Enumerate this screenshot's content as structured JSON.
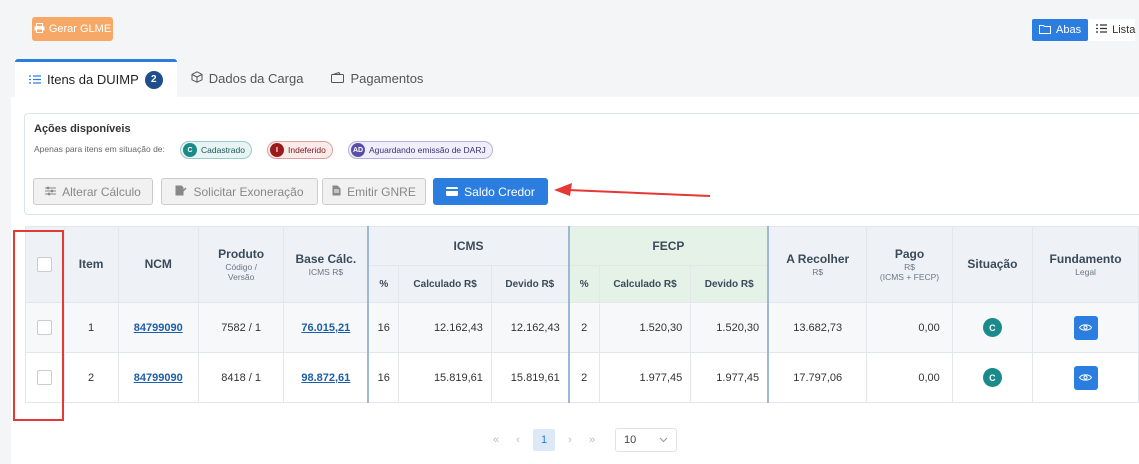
{
  "top": {
    "gerar_label": "Gerar GLME",
    "view_abas": "Abas",
    "view_lista": "Lista"
  },
  "tabs": [
    {
      "label": "Itens da DUIMP",
      "badge": "2"
    },
    {
      "label": "Dados da Carga"
    },
    {
      "label": "Pagamentos"
    }
  ],
  "actions": {
    "title": "Ações disponíveis",
    "note": "Apenas para itens em situação de:",
    "chips": [
      {
        "dot": "C",
        "label": "Cadastrado"
      },
      {
        "dot": "I",
        "label": "Indeferido"
      },
      {
        "dot": "AD",
        "label": "Aguardando emissão de DARJ"
      }
    ],
    "buttons": [
      "Alterar Cálculo",
      "Solicitar Exoneração",
      "Emitir GNRE",
      "Saldo Credor"
    ]
  },
  "table": {
    "headers": {
      "item": "Item",
      "ncm": "NCM",
      "produto": "Produto",
      "produto_sub": "Código / Versão",
      "base": "Base Cálc.",
      "base_sub": "ICMS R$",
      "icms": "ICMS",
      "fecp": "FECP",
      "pct": "%",
      "calculado": "Calculado R$",
      "devido": "Devido R$",
      "recolher": "A Recolher",
      "recolher_sub": "R$",
      "pago": "Pago",
      "pago_sub1": "R$",
      "pago_sub2": "(ICMS + FECP)",
      "situacao": "Situação",
      "fundamento": "Fundamento",
      "fundamento_sub": "Legal"
    },
    "rows": [
      {
        "item": "1",
        "ncm": "84799090",
        "produto": "7582 / 1",
        "base": "76.015,21",
        "icms_pct": "16",
        "icms_calc": "12.162,43",
        "icms_dev": "12.162,43",
        "fecp_pct": "2",
        "fecp_calc": "1.520,30",
        "fecp_dev": "1.520,30",
        "recolher": "13.682,73",
        "pago": "0,00",
        "situacao": "C"
      },
      {
        "item": "2",
        "ncm": "84799090",
        "produto": "8418 / 1",
        "base": "98.872,61",
        "icms_pct": "16",
        "icms_calc": "15.819,61",
        "icms_dev": "15.819,61",
        "fecp_pct": "2",
        "fecp_calc": "1.977,45",
        "fecp_dev": "1.977,45",
        "recolher": "17.797,06",
        "pago": "0,00",
        "situacao": "C"
      }
    ]
  },
  "pager": {
    "current": "1",
    "page_size": "10"
  },
  "colors": {
    "accent": "#2b7de0",
    "orange": "#f7a766",
    "annotation": "#e53935",
    "situacao": "#1a8a8a"
  }
}
